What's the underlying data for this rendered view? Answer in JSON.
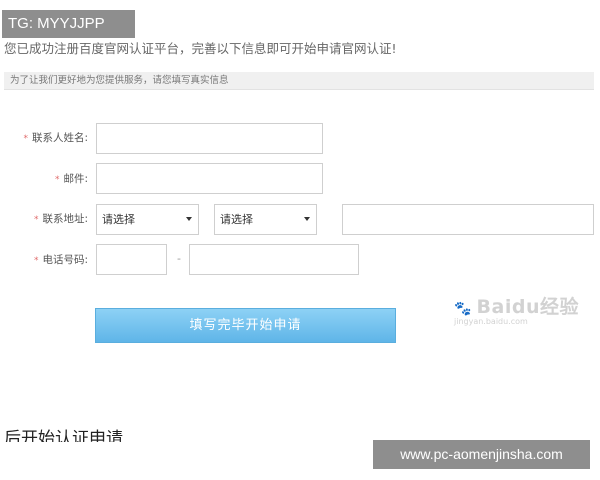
{
  "overlay": {
    "tg_tag": "TG: MYYJJPP",
    "site_url": "www.pc-aomenjinsha.com"
  },
  "page": {
    "intro_text": "您已成功注册百度官网认证平台，完善以下信息即可开始申请官网认证!",
    "info_bar_text": "为了让我们更好地为您提供服务，请您填写真实信息",
    "bottom_cut_text": "后开始认证申请"
  },
  "form": {
    "required_mark": "*",
    "contact_name_label": "联系人姓名:",
    "email_label": "邮件:",
    "address_label": "联系地址:",
    "phone_label": "电话号码:",
    "contact_name_value": "",
    "email_value": "",
    "province_select": "请选择",
    "city_select": "请选择",
    "address_detail_value": "",
    "phone_area_value": "",
    "phone_dash": "-",
    "phone_number_value": "",
    "submit_label": "填写完毕开始申请"
  },
  "watermark": {
    "brand": "Baidu经验",
    "url": "jingyan.baidu.com"
  },
  "colors": {
    "button_top": "#8dd1f5",
    "button_bottom": "#5fb5e8",
    "required_star": "#e06b6b",
    "overlay_bg": "#8e8e8e"
  }
}
